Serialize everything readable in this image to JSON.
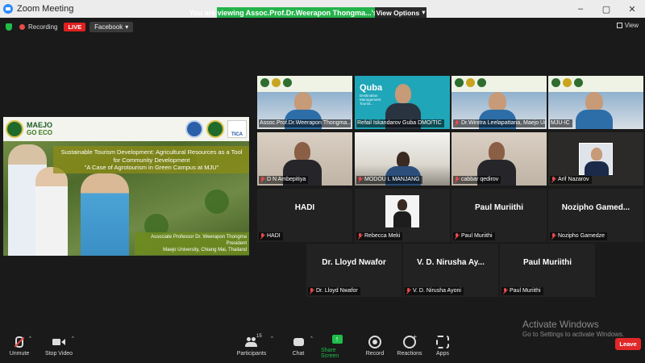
{
  "window": {
    "title": "Zoom Meeting",
    "share_banner": "You are viewing Assoc.Prof.Dr.Weerapon Thongma...'s screen",
    "view_options": "View Options",
    "controls": [
      "–",
      "▢",
      "✕"
    ]
  },
  "topbar": {
    "recording_label": "Recording",
    "live_label": "LIVE",
    "stream_target": "Facebook",
    "view_label": "View"
  },
  "shared_screen": {
    "logo_text": "MAEJO",
    "logo_sub": "GO ECO",
    "partner_logo": "TICA",
    "title_line1": "Sustainable Tourism Development: Agricultural Resources as a Tool",
    "title_line2": "for Community Development",
    "title_line3": "\"A Case of Agrotourism in Green Campus at MJU\"",
    "presenter_name": "Associate Professor Dr. Weerapon Thongma",
    "presenter_role": "President",
    "presenter_org": "Maejo University, Chiang Mai, Thailand"
  },
  "participants": [
    {
      "label": "Assoc.Prof.Dr.Weerapon Thongma...Pr...",
      "muted": false,
      "active": true,
      "kind": "slide"
    },
    {
      "label": "Refail Iskandarov Guba DMO/TIC",
      "muted": false,
      "active": false,
      "kind": "quba",
      "brand": "Quba",
      "brand_sub": "Destination Management Tourist..."
    },
    {
      "label": "Dr.Winitra Leelapattana, Maejo Un...",
      "muted": true,
      "active": false,
      "kind": "slide"
    },
    {
      "label": "MJU-IC",
      "muted": false,
      "active": false,
      "kind": "slide"
    },
    {
      "label": "D N Ambepitiya",
      "muted": true,
      "active": false,
      "kind": "room"
    },
    {
      "label": "MODOU L MANJANG",
      "muted": true,
      "active": false,
      "kind": "window"
    },
    {
      "label": "cabbar qedirov",
      "muted": true,
      "active": false,
      "kind": "room"
    },
    {
      "label": "Arif Nazarov",
      "muted": true,
      "active": false,
      "kind": "portrait"
    },
    {
      "label": "HADI",
      "muted": true,
      "active": false,
      "kind": "name",
      "display": "HADI"
    },
    {
      "label": "Rebecca Meki",
      "muted": true,
      "active": false,
      "kind": "rebecca"
    },
    {
      "label": "Paul Muriithi",
      "muted": true,
      "active": false,
      "kind": "name",
      "display": "Paul Muriithi"
    },
    {
      "label": "Nozipho Gamedze",
      "muted": true,
      "active": false,
      "kind": "name",
      "display": "Nozipho Gamed..."
    },
    {
      "label": "Dr. Lloyd Nwafor",
      "muted": true,
      "active": false,
      "kind": "name",
      "display": "Dr. Lloyd Nwafor"
    },
    {
      "label": "V. D. Nirusha Ayoni",
      "muted": true,
      "active": false,
      "kind": "name",
      "display": "V. D. Nirusha Ay..."
    },
    {
      "label": "Paul Muriithi",
      "muted": true,
      "active": false,
      "kind": "name",
      "display": "Paul Muriithi"
    }
  ],
  "watermark": {
    "line1": "Activate Windows",
    "line2": "Go to Settings to activate Windows."
  },
  "toolbar": {
    "unmute": "Unmute",
    "stop_video": "Stop Video",
    "participants": "Participants",
    "participant_count": "15",
    "chat": "Chat",
    "share_screen": "Share Screen",
    "record": "Record",
    "reactions": "Reactions",
    "apps": "Apps",
    "leave": "Leave"
  },
  "colors": {
    "share_banner": "#24b34b",
    "leave": "#e02828",
    "active_speaker": "#e6d400",
    "muted_mic": "#e84b4b"
  }
}
